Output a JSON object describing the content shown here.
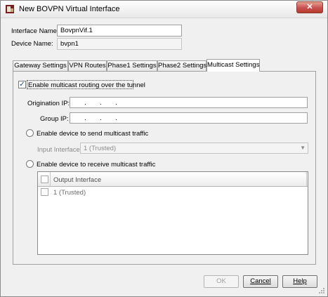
{
  "window": {
    "title": "New BOVPN Virtual Interface",
    "close_label": "✕"
  },
  "form": {
    "interface_name_label": "Interface Name:",
    "interface_name_value": "BovpnVif.1",
    "device_name_label": "Device Name:",
    "device_name_value": "bvpn1"
  },
  "tabs": [
    {
      "label": "Gateway Settings",
      "active": false
    },
    {
      "label": "VPN Routes",
      "active": false
    },
    {
      "label": "Phase1 Settings",
      "active": false
    },
    {
      "label": "Phase2 Settings",
      "active": false
    },
    {
      "label": "Multicast Settings",
      "active": true
    }
  ],
  "multicast": {
    "enable_label": "Enable multicast routing over the tunnel",
    "enable_checked": true,
    "origination_ip_label": "Origination IP:",
    "origination_ip_value": ".   .   .",
    "group_ip_label": "Group IP:",
    "group_ip_value": ".   .   .",
    "send_label": "Enable device to send multicast traffic",
    "input_interface_label": "Input Interface:",
    "input_interface_value": "1 (Trusted)",
    "receive_label": "Enable device to receive multicast traffic",
    "table": {
      "header": "Output Interface",
      "rows": [
        {
          "label": "1 (Trusted)",
          "checked": false
        }
      ]
    }
  },
  "buttons": {
    "ok": "OK",
    "cancel": "Cancel",
    "help": "Help"
  },
  "colors": {
    "close_red": "#c75050",
    "checkmark_blue": "#1a3d8f"
  }
}
